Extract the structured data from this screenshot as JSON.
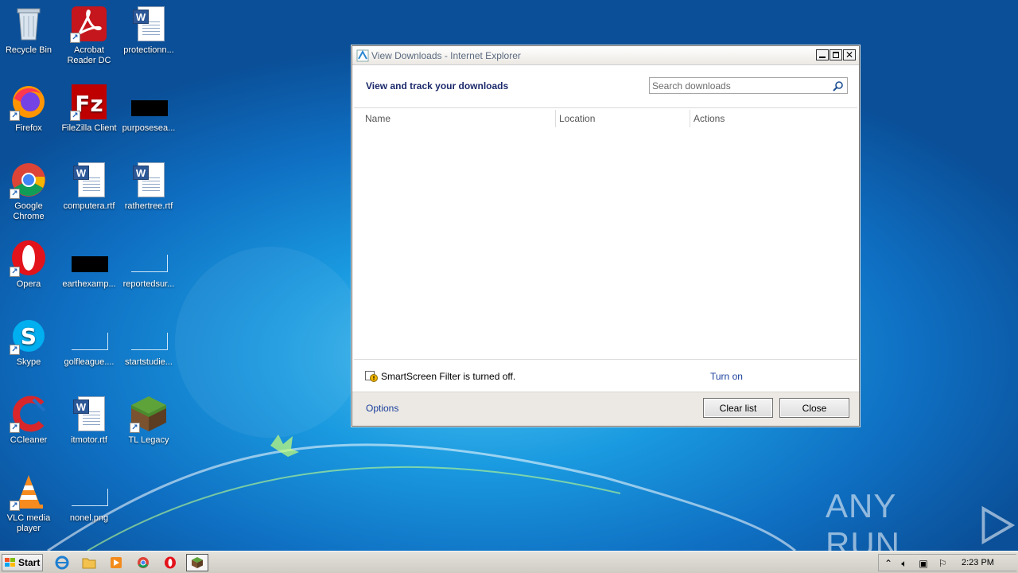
{
  "desktop": {
    "icons": [
      {
        "label": "Recycle Bin"
      },
      {
        "label": "Acrobat Reader DC"
      },
      {
        "label": "protectionn..."
      },
      {
        "label": "Firefox"
      },
      {
        "label": "FileZilla Client"
      },
      {
        "label": "purposesea..."
      },
      {
        "label": "Google Chrome"
      },
      {
        "label": "computera.rtf"
      },
      {
        "label": "rathertree.rtf"
      },
      {
        "label": "Opera"
      },
      {
        "label": "earthexamp..."
      },
      {
        "label": "reportedsur..."
      },
      {
        "label": "Skype"
      },
      {
        "label": "golfleague...."
      },
      {
        "label": "startstudie..."
      },
      {
        "label": "CCleaner"
      },
      {
        "label": "itmotor.rtf"
      },
      {
        "label": "TL Legacy"
      },
      {
        "label": "VLC media player"
      },
      {
        "label": "nonel.png"
      }
    ],
    "watermark": "ANY RUN"
  },
  "window": {
    "title": "View Downloads - Internet Explorer",
    "heading": "View and track your downloads",
    "search_placeholder": "Search downloads",
    "columns": [
      "Name",
      "Location",
      "Actions"
    ],
    "smartscreen_message": "SmartScreen Filter is turned off.",
    "turn_on_link": "Turn on",
    "options_link": "Options",
    "clear_list_button": "Clear list",
    "close_button": "Close",
    "close_glyph": "✕"
  },
  "taskbar": {
    "start_label": "Start",
    "clock": "2:23 PM"
  }
}
